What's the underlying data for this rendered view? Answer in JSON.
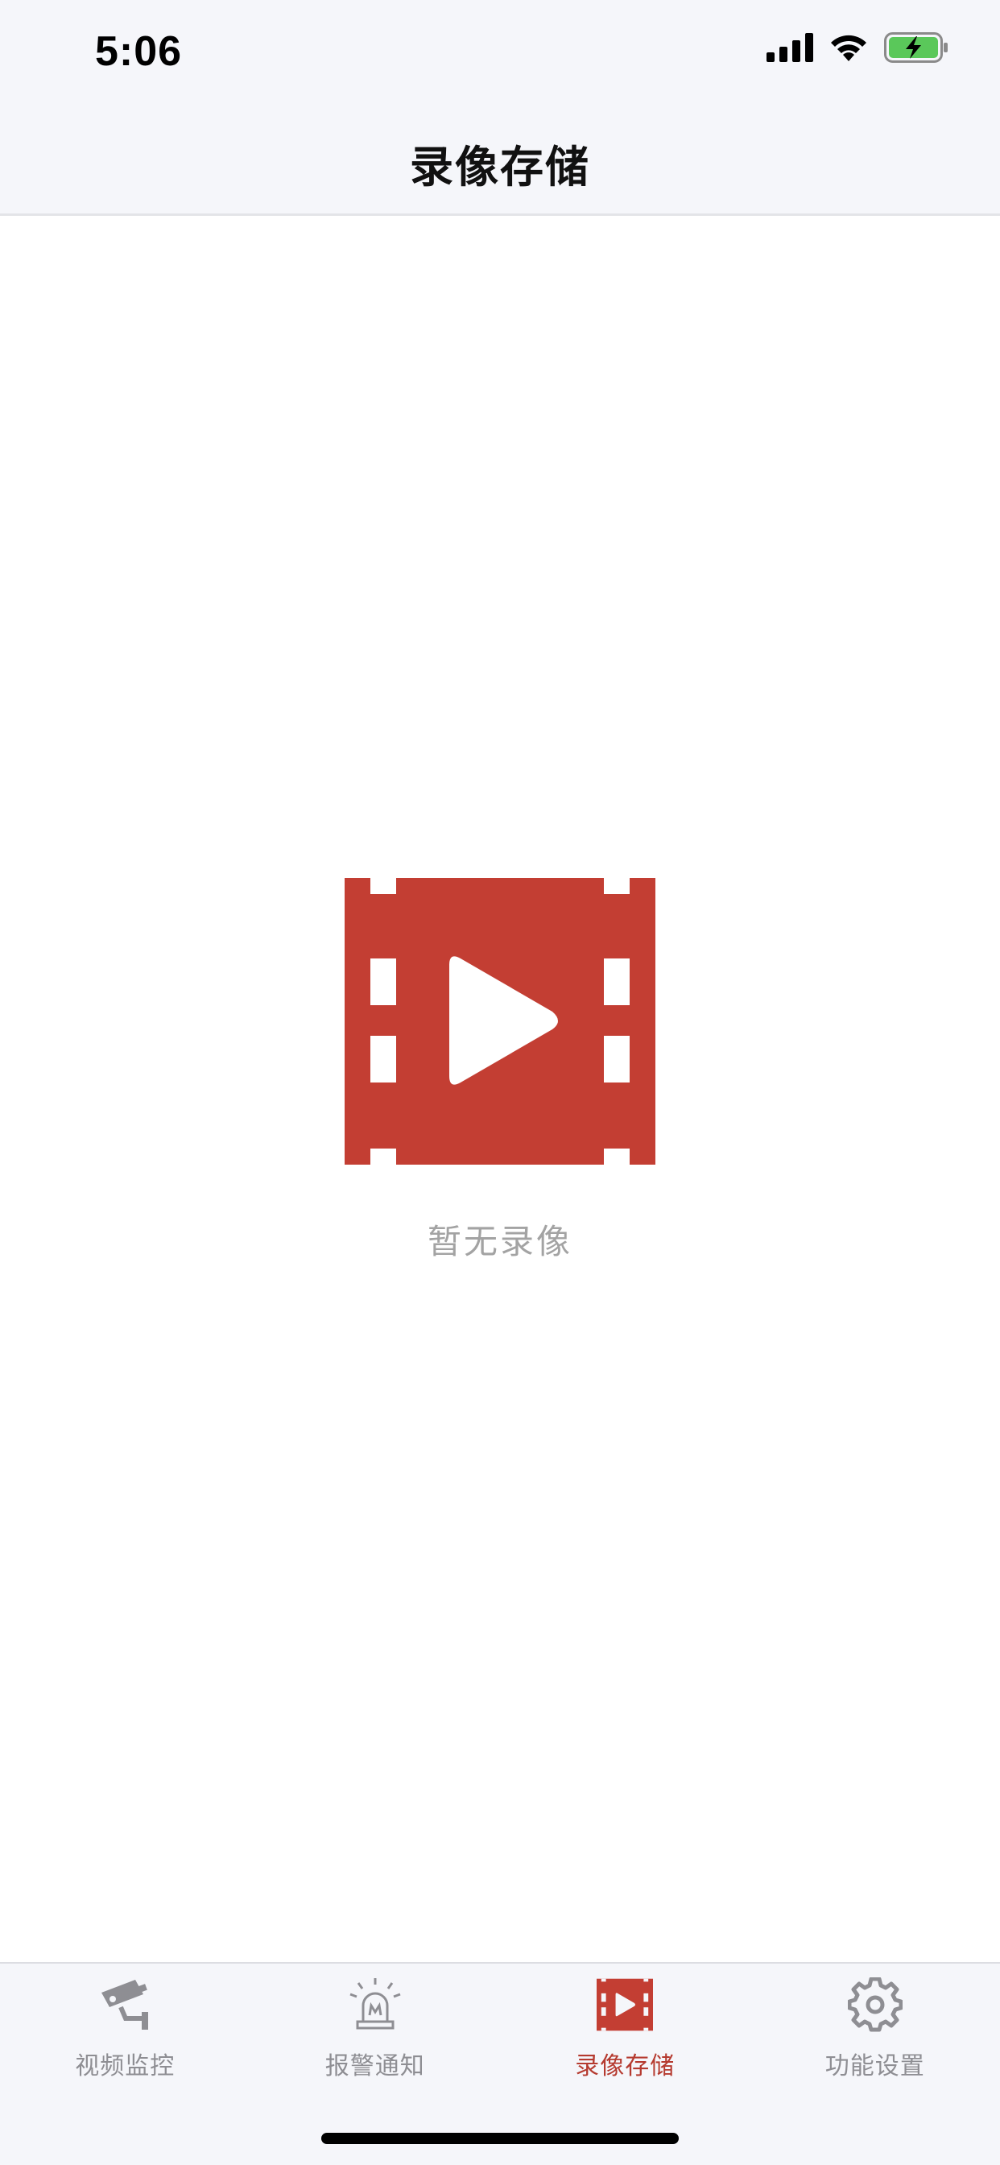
{
  "status_bar": {
    "time": "5:06",
    "icons": [
      "cellular-signal-icon",
      "wifi-icon",
      "battery-charging-icon"
    ],
    "battery_color": "#5ac85a"
  },
  "nav": {
    "title": "录像存储"
  },
  "empty_state": {
    "icon": "video-film-icon",
    "message": "暂无录像",
    "icon_color": "#c33e33"
  },
  "tab_bar": {
    "active_color": "#b53a2f",
    "inactive_color": "#8e8e93",
    "tabs": [
      {
        "label": "视频监控",
        "icon": "security-camera-icon",
        "active": false
      },
      {
        "label": "报警通知",
        "icon": "alarm-siren-icon",
        "active": false
      },
      {
        "label": "录像存储",
        "icon": "video-film-icon",
        "active": true
      },
      {
        "label": "功能设置",
        "icon": "gear-icon",
        "active": false
      }
    ]
  }
}
